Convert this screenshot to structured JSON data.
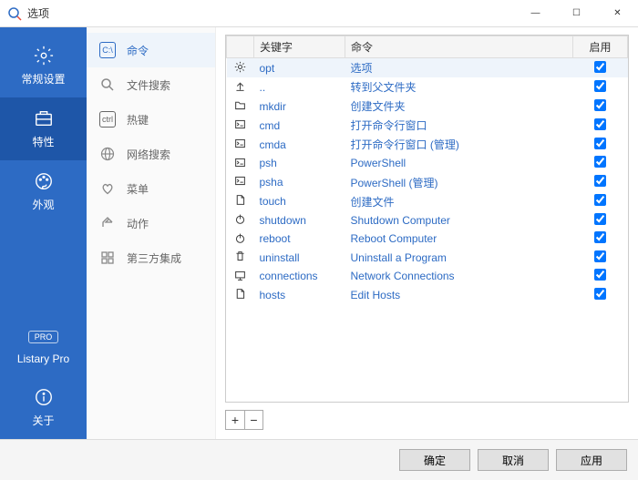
{
  "window": {
    "title": "选项"
  },
  "titlebar_icons": {
    "min": "—",
    "max": "☐",
    "close": "✕"
  },
  "sidebar": {
    "items": [
      {
        "label": "常规设置",
        "icon": "gear"
      },
      {
        "label": "特性",
        "icon": "briefcase"
      },
      {
        "label": "外观",
        "icon": "palette"
      }
    ],
    "pro_label": "Listary Pro",
    "about_label": "关于"
  },
  "sublist": {
    "items": [
      {
        "label": "命令",
        "icon": ">_"
      },
      {
        "label": "文件搜索",
        "icon": "search"
      },
      {
        "label": "热键",
        "icon": "ctrl"
      },
      {
        "label": "网络搜索",
        "icon": "globe"
      },
      {
        "label": "菜单",
        "icon": "heart"
      },
      {
        "label": "动作",
        "icon": "share"
      },
      {
        "label": "第三方集成",
        "icon": "grid"
      }
    ]
  },
  "table": {
    "headers": {
      "keyword": "关键字",
      "command": "命令",
      "enabled": "启用"
    },
    "rows": [
      {
        "icon": "gear",
        "keyword": "opt",
        "command": "选项",
        "enabled": true,
        "selected": true
      },
      {
        "icon": "up",
        "keyword": "..",
        "command": "转到父文件夹",
        "enabled": true
      },
      {
        "icon": "folder",
        "keyword": "mkdir",
        "command": "创建文件夹",
        "enabled": true
      },
      {
        "icon": "term",
        "keyword": "cmd",
        "command": "打开命令行窗口",
        "enabled": true
      },
      {
        "icon": "term",
        "keyword": "cmda",
        "command": "打开命令行窗口 (管理)",
        "enabled": true
      },
      {
        "icon": "term",
        "keyword": "psh",
        "command": "PowerShell",
        "enabled": true
      },
      {
        "icon": "term",
        "keyword": "psha",
        "command": "PowerShell (管理)",
        "enabled": true
      },
      {
        "icon": "file",
        "keyword": "touch",
        "command": "创建文件",
        "enabled": true
      },
      {
        "icon": "power",
        "keyword": "shutdown",
        "command": "Shutdown Computer",
        "enabled": true
      },
      {
        "icon": "power",
        "keyword": "reboot",
        "command": "Reboot Computer",
        "enabled": true
      },
      {
        "icon": "trash",
        "keyword": "uninstall",
        "command": "Uninstall a Program",
        "enabled": true
      },
      {
        "icon": "net",
        "keyword": "connections",
        "command": "Network Connections",
        "enabled": true
      },
      {
        "icon": "file",
        "keyword": "hosts",
        "command": "Edit Hosts",
        "enabled": true
      }
    ]
  },
  "addremove": {
    "add": "+",
    "remove": "−"
  },
  "footer": {
    "ok": "确定",
    "cancel": "取消",
    "apply": "应用"
  }
}
